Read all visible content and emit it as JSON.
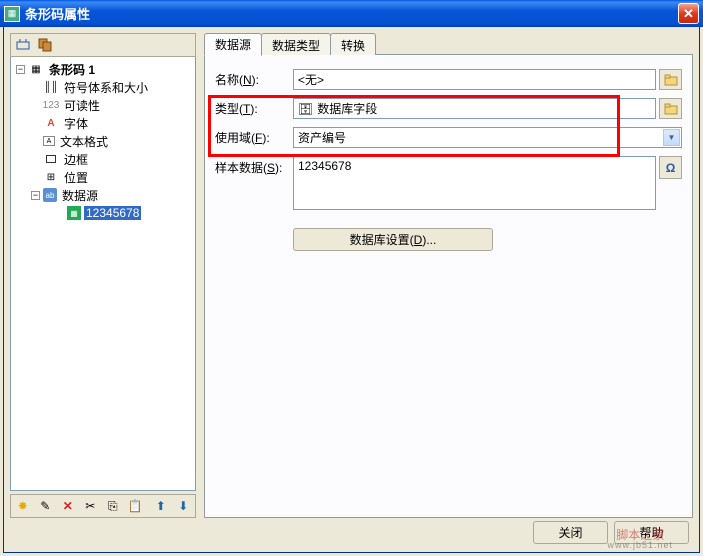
{
  "window": {
    "title": "条形码属性"
  },
  "tree": {
    "root": "条形码 1",
    "items": [
      {
        "label": "符号体系和大小"
      },
      {
        "label": "可读性"
      },
      {
        "label": "字体"
      },
      {
        "label": "文本格式"
      },
      {
        "label": "边框"
      },
      {
        "label": "位置"
      },
      {
        "label": "数据源"
      }
    ],
    "data_value": "12345678"
  },
  "tabs": {
    "t1": "数据源",
    "t2": "数据类型",
    "t3": "转换"
  },
  "form": {
    "name_label": "名称(N):",
    "name_value": "<无>",
    "type_label": "类型(T):",
    "type_value": "数据库字段",
    "field_label": "使用域(F):",
    "field_value": "资产编号",
    "sample_label": "样本数据(S):",
    "sample_value": "12345678",
    "db_button": "数据库设置(D)..."
  },
  "buttons": {
    "close": "关闭",
    "help": "帮助"
  },
  "watermark": {
    "text": "脚本之家",
    "url": "www.jb51.net"
  }
}
